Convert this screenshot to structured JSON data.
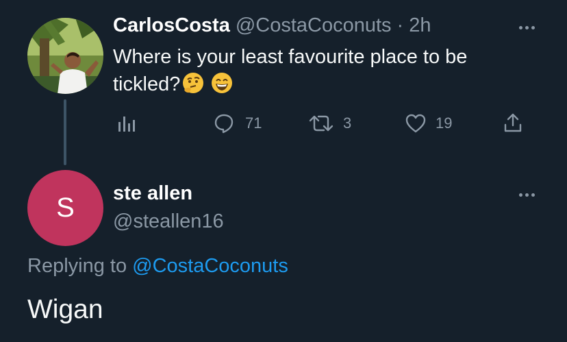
{
  "tweet": {
    "author_name": "CarlosCosta",
    "handle": "@CostaCoconuts",
    "separator": "·",
    "time": "2h",
    "text": "Where is your least favourite place to be tickled?",
    "emojis": [
      "thinking-face",
      "grinning-face"
    ],
    "avatar_icon": "profile-photo",
    "actions": {
      "analytics_icon": "analytics-icon",
      "reply_count": "71",
      "retweet_count": "3",
      "like_count": "19",
      "share_icon": "share-icon"
    }
  },
  "reply": {
    "avatar_letter": "S",
    "avatar_color": "#c0345d",
    "author_name": "ste allen",
    "handle": "@steallen16",
    "replying_label": "Replying to",
    "replying_to": "@CostaCoconuts",
    "text": "Wigan"
  },
  "colors": {
    "background": "#15202b",
    "text": "#f7f9f9",
    "secondary": "#8b98a5",
    "link": "#1d9bf0"
  }
}
